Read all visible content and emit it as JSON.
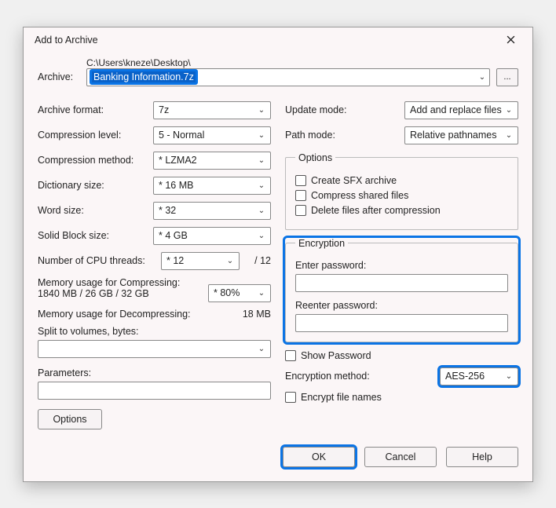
{
  "window": {
    "title": "Add to Archive"
  },
  "archive": {
    "label": "Archive:",
    "path_prefix": "C:\\Users\\kneze\\Desktop\\",
    "filename": "Banking Information.7z",
    "browse": "..."
  },
  "left": {
    "format_label": "Archive format:",
    "format_value": "7z",
    "level_label": "Compression level:",
    "level_value": "5 - Normal",
    "method_label": "Compression method:",
    "method_value": "* LZMA2",
    "dict_label": "Dictionary size:",
    "dict_value": "* 16 MB",
    "word_label": "Word size:",
    "word_value": "* 32",
    "solid_label": "Solid Block size:",
    "solid_value": "* 4 GB",
    "cpu_label": "Number of CPU threads:",
    "cpu_value": "* 12",
    "cpu_total": "/ 12",
    "mem_comp_label": "Memory usage for Compressing:",
    "mem_comp_value": "1840 MB / 26 GB / 32 GB",
    "mem_comp_pct": "* 80%",
    "mem_decomp_label": "Memory usage for Decompressing:",
    "mem_decomp_value": "18 MB",
    "split_label": "Split to volumes, bytes:",
    "params_label": "Parameters:",
    "options_btn": "Options"
  },
  "right": {
    "update_label": "Update mode:",
    "update_value": "Add and replace files",
    "path_label": "Path mode:",
    "path_value": "Relative pathnames",
    "options_legend": "Options",
    "opt_sfx": "Create SFX archive",
    "opt_shared": "Compress shared files",
    "opt_delete": "Delete files after compression",
    "enc_legend": "Encryption",
    "enter_pass": "Enter password:",
    "reenter_pass": "Reenter password:",
    "show_pass": "Show Password",
    "enc_method_label": "Encryption method:",
    "enc_method_value": "AES-256",
    "enc_names": "Encrypt file names"
  },
  "buttons": {
    "ok": "OK",
    "cancel": "Cancel",
    "help": "Help"
  }
}
